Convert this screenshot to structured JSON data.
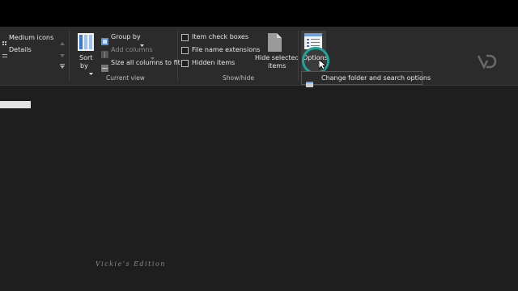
{
  "ribbon": {
    "layout": {
      "medium_icons": "Medium icons",
      "details": "Details"
    },
    "current_view": {
      "sort_by_line1": "Sort",
      "sort_by_line2": "by",
      "group_by": "Group by",
      "add_columns": "Add columns",
      "size_all_columns": "Size all columns to fit",
      "group_label": "Current view"
    },
    "show_hide": {
      "item_check_boxes": "Item check boxes",
      "file_name_extensions": "File name extensions",
      "hidden_items": "Hidden items",
      "hide_selected_line1": "Hide selected",
      "hide_selected_line2": "items",
      "group_label": "Show/hide"
    },
    "options": {
      "label": "Options"
    }
  },
  "tooltip": {
    "text": "Change folder and search options"
  },
  "watermark": {
    "text": "Vickie's Edition"
  },
  "colors": {
    "ring": "#1fa59b",
    "ribbon_bg": "#2b2b2b",
    "content_bg": "#1e1e1e"
  }
}
